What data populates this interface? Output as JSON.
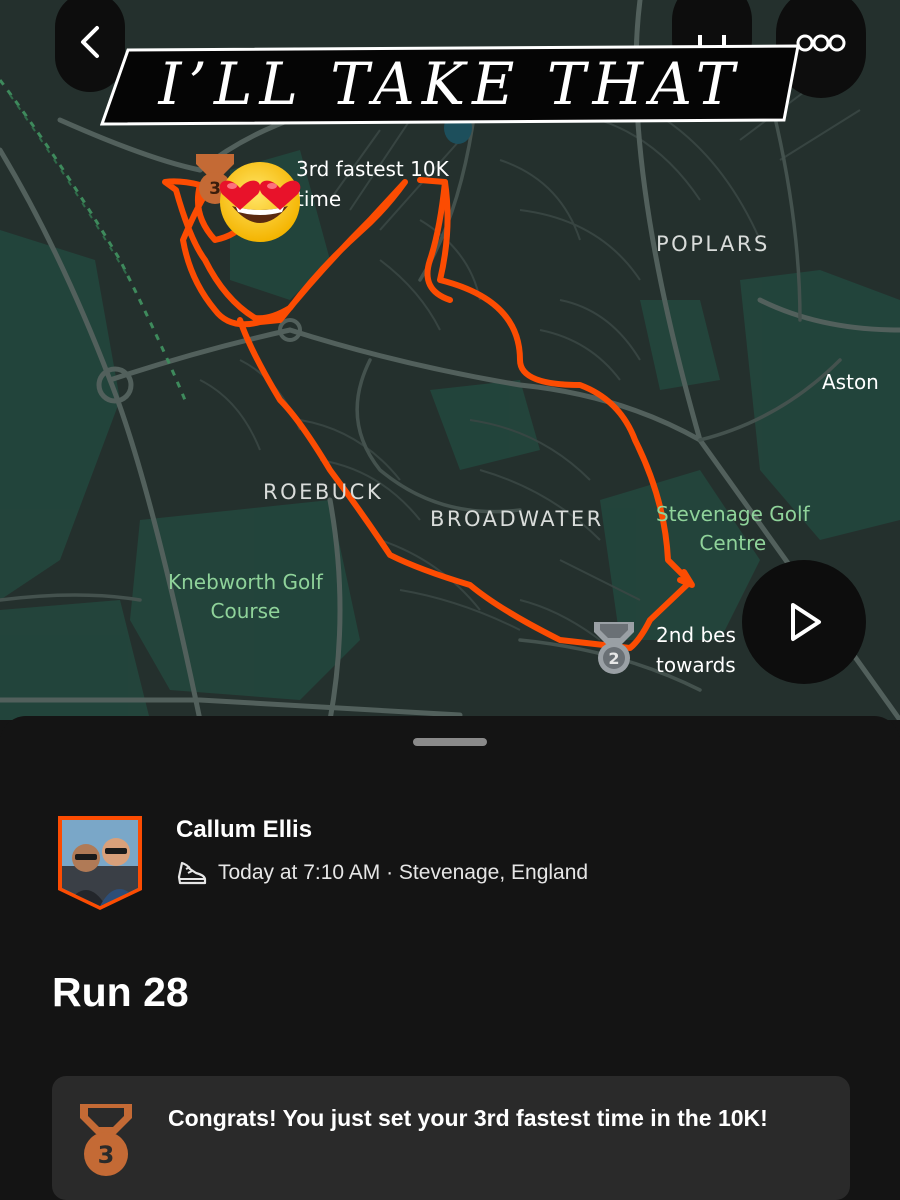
{
  "overlay": {
    "banner_text": "I’LL TAKE THAT",
    "emoji": "heart-eyes-smiling-face"
  },
  "map": {
    "districts": [
      "POPLARS",
      "ROEBUCK",
      "BROADWATER"
    ],
    "places": [
      "Aston"
    ],
    "parks": [
      {
        "line1": "Stevenage Golf",
        "line2": "Centre"
      },
      {
        "line1": "Knebworth Golf",
        "line2": "Course"
      }
    ],
    "segments": [
      {
        "line1": "3rd fastest 10K",
        "line2": "time",
        "rank": "3"
      },
      {
        "line1": "2nd bes",
        "line2": "towards",
        "rank": "2"
      }
    ],
    "route_color": "#fc4c02"
  },
  "controls": {
    "back_icon": "chevron-left-icon",
    "save_icon": "bookmark-icon",
    "more_icon": "more-dots-icon",
    "play_icon": "play-icon"
  },
  "activity": {
    "athlete_name": "Callum Ellis",
    "sport_icon": "running-shoe-icon",
    "meta": "Today at 7:10 AM · Stevenage, England",
    "title": "Run 28"
  },
  "achievement": {
    "rank": "3",
    "message": "Congrats! You just set your 3rd fastest time in the 10K!"
  },
  "colors": {
    "brand": "#fc4c02",
    "bronze": "#c46a35",
    "silver": "#9aa0a5"
  }
}
